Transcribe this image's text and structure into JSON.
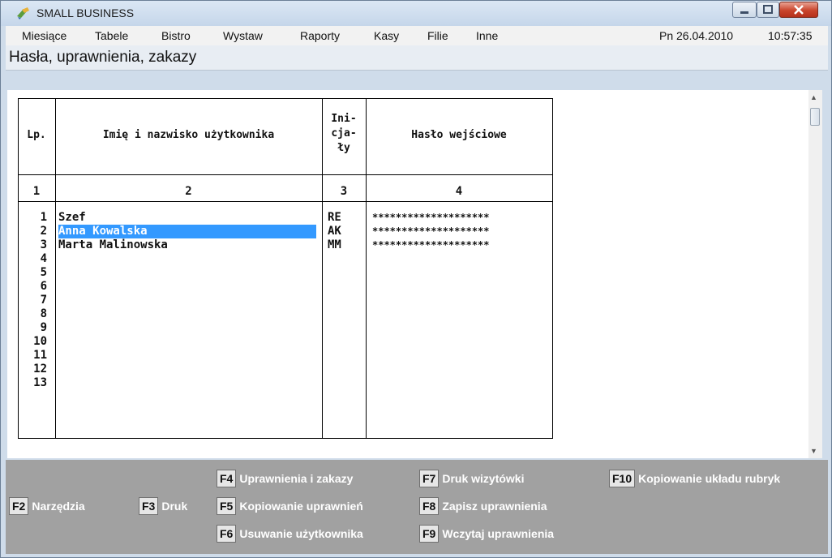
{
  "window": {
    "title": "SMALL BUSINESS"
  },
  "menu": {
    "items": [
      {
        "label": "Miesiące"
      },
      {
        "label": "Tabele"
      },
      {
        "label": "Bistro"
      },
      {
        "label": "Wystaw"
      },
      {
        "label": "Raporty"
      },
      {
        "label": "Kasy"
      },
      {
        "label": "Filie"
      },
      {
        "label": "Inne"
      }
    ],
    "date": "Pn 26.04.2010",
    "time": "10:57:35"
  },
  "page": {
    "heading": "Hasła, uprawnienia, zakazy"
  },
  "table": {
    "headers": {
      "lp": "Lp.",
      "name": "Imię i nazwisko użytkownika",
      "init1": "Ini-",
      "init2": "cja-",
      "init3": "ły",
      "password": "Hasło wejściowe"
    },
    "column_numbers": [
      "1",
      "2",
      "3",
      "4"
    ],
    "row_numbers": [
      "1",
      "2",
      "3",
      "4",
      "5",
      "6",
      "7",
      "8",
      "9",
      "10",
      "11",
      "12",
      "13"
    ],
    "rows": [
      {
        "name": "Szef",
        "initials": "RE",
        "password": "********************"
      },
      {
        "name": "Anna Kowalska",
        "initials": "AK",
        "password": "********************",
        "selected": true
      },
      {
        "name": "Marta Malinowska",
        "initials": "MM",
        "password": "********************"
      }
    ]
  },
  "function_keys": [
    {
      "key": "F2",
      "label": "Narzędzia"
    },
    {
      "key": "F3",
      "label": "Druk"
    },
    {
      "key": "F4",
      "label": "Uprawnienia i zakazy"
    },
    {
      "key": "F5",
      "label": "Kopiowanie uprawnień"
    },
    {
      "key": "F6",
      "label": "Usuwanie użytkownika"
    },
    {
      "key": "F7",
      "label": "Druk wizytówki"
    },
    {
      "key": "F8",
      "label": "Zapisz uprawnienia"
    },
    {
      "key": "F9",
      "label": "Wczytaj uprawnienia"
    },
    {
      "key": "F10",
      "label": "Kopiowanie układu rubryk"
    }
  ],
  "colors": {
    "selection": "#3399ff",
    "fkey_bar": "#a1a1a1"
  }
}
